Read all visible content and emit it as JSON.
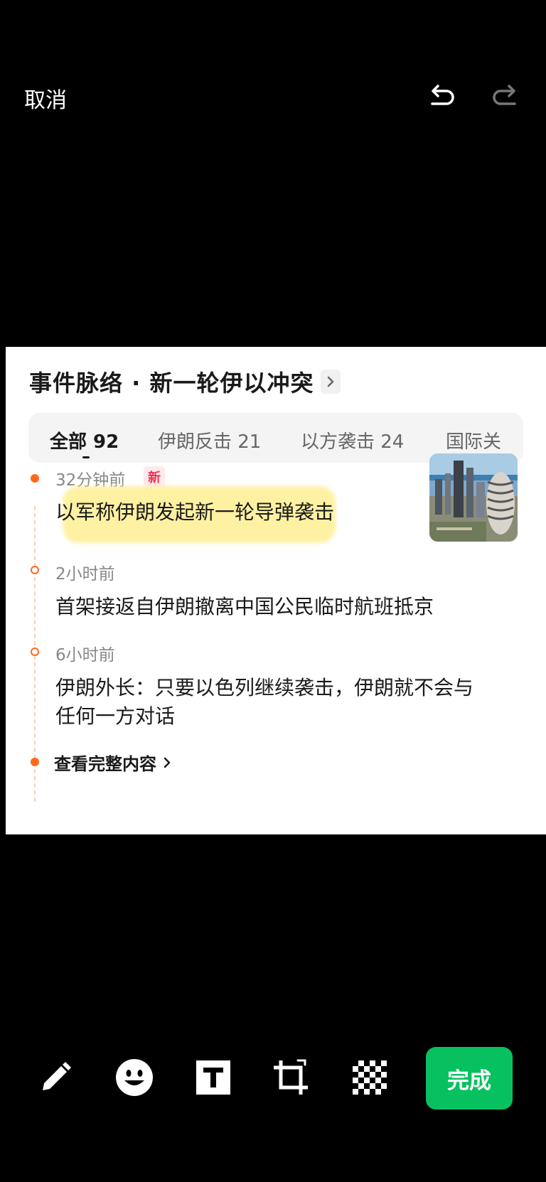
{
  "topbar": {
    "cancel_label": "取消",
    "undo_icon": "undo-icon",
    "redo_icon": "redo-icon"
  },
  "card": {
    "title": "事件脉络 · 新一轮伊以冲突",
    "tabs": [
      {
        "label": "全部 92",
        "active": true
      },
      {
        "label": "伊朗反击 21",
        "active": false
      },
      {
        "label": "以方袭击 24",
        "active": false
      },
      {
        "label": "国际关",
        "active": false
      }
    ],
    "timeline": [
      {
        "time": "32分钟前",
        "badge": "新",
        "text": "以军称伊朗发起新一轮导弹袭击",
        "has_image": true
      },
      {
        "time": "2小时前",
        "text": "首架接返自伊朗撤离中国公民临时航班抵京"
      },
      {
        "time": "6小时前",
        "text_line1": "伊朗外长：只要以色列继续袭击，伊朗就不会与",
        "text_line2": "任何一方对话"
      }
    ],
    "more_label": "查看完整内容"
  },
  "toolbar": {
    "tools": [
      "pencil-icon",
      "emoji-icon",
      "text-icon",
      "crop-icon",
      "mosaic-icon"
    ],
    "done_label": "完成"
  },
  "colors": {
    "accent_orange": "#ff6a1a",
    "done_green": "#07c160",
    "highlight_yellow": "#fff099",
    "new_badge_red": "#f0334f"
  }
}
